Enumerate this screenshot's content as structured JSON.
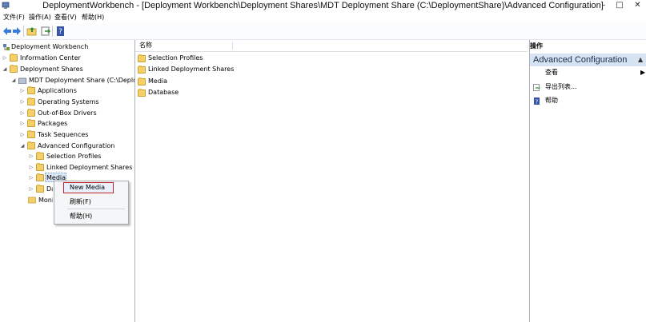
{
  "window": {
    "title": "DeploymentWorkbench - [Deployment Workbench\\Deployment Shares\\MDT Deployment Share (C:\\DeploymentShare)\\Advanced Configuration]",
    "minimize_glyph": "–",
    "maximize_glyph": "□",
    "close_glyph": "✕"
  },
  "menu": {
    "file": "文件(F)",
    "action": "操作(A)",
    "view": "查看(V)",
    "help": "帮助(H)"
  },
  "toolbar": {
    "icons": [
      "back-icon",
      "forward-icon",
      "up-folder-icon",
      "export-icon",
      "help-icon"
    ]
  },
  "tree": {
    "root": "Deployment Workbench",
    "information_center": "Information Center",
    "deployment_shares": "Deployment Shares",
    "mdt_share": "MDT Deployment Share (C:\\Deployme",
    "applications": "Applications",
    "operating_systems": "Operating Systems",
    "drivers": "Out-of-Box Drivers",
    "packages": "Packages",
    "task_sequences": "Task Sequences",
    "advanced_configuration": "Advanced Configuration",
    "selection_profiles": "Selection Profiles",
    "linked_deployment_shares": "Linked Deployment Shares",
    "media": "Media",
    "database_partial": "Da",
    "monitoring_partial": "Moni"
  },
  "list": {
    "column_name": "名称",
    "items": [
      "Selection Profiles",
      "Linked Deployment Shares",
      "Media",
      "Database"
    ]
  },
  "actions": {
    "header": "操作",
    "section": "Advanced Configuration",
    "view": "查看",
    "export_list": "导出列表...",
    "help": "帮助"
  },
  "context_menu": {
    "new_media": "New Media",
    "refresh": "刷新(F)",
    "help": "帮助(H)"
  },
  "colors": {
    "accent_selection": "#d6e3f3",
    "highlight_border": "#c0242a"
  }
}
